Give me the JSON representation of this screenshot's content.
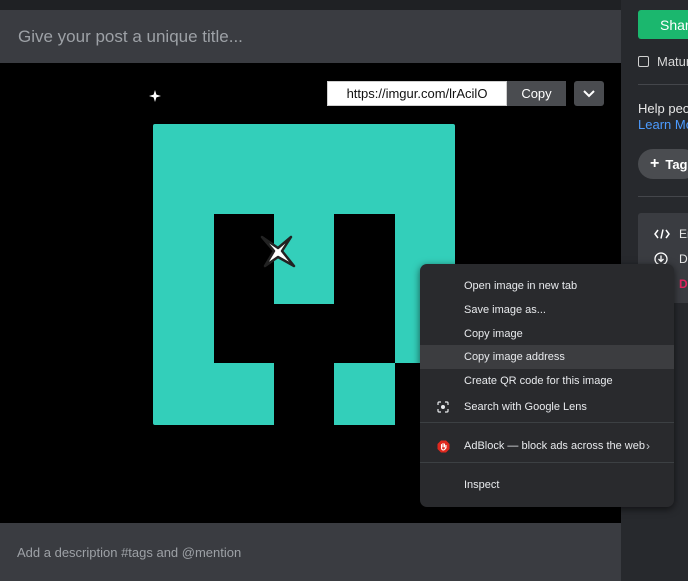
{
  "post": {
    "title_placeholder": "Give your post a unique title...",
    "description_placeholder": "Add a description #tags and @mention"
  },
  "image_toolbar": {
    "url": "https://imgur.com/lrAcilO",
    "copy_label": "Copy"
  },
  "sidebar": {
    "share_label": "Shar",
    "mature_label": "Matur",
    "help_text": "Help peo",
    "learn_more": "Learn Mo",
    "tag_label": "Tag",
    "panel_items": [
      {
        "icon": "code-icon",
        "label": "Er"
      },
      {
        "icon": "download-icon",
        "label": "Do"
      },
      {
        "icon": "",
        "label": "D"
      }
    ]
  },
  "context_menu": {
    "items": [
      {
        "label": "Open image in new tab"
      },
      {
        "label": "Save image as..."
      },
      {
        "label": "Copy image"
      },
      {
        "label": "Copy image address",
        "highlighted": true
      },
      {
        "label": "Create QR code for this image"
      },
      {
        "label": "Search with Google Lens",
        "icon": "google-lens-icon"
      },
      {
        "label": "AdBlock — block ads across the web",
        "icon": "adblock-icon"
      },
      {
        "label": "Inspect"
      }
    ]
  },
  "colors": {
    "logo_teal": "#33cfba",
    "share_green": "#1bb76e",
    "link_blue": "#4c9bff",
    "danger_red": "#e0245e",
    "adblock_red": "#e0281e"
  }
}
